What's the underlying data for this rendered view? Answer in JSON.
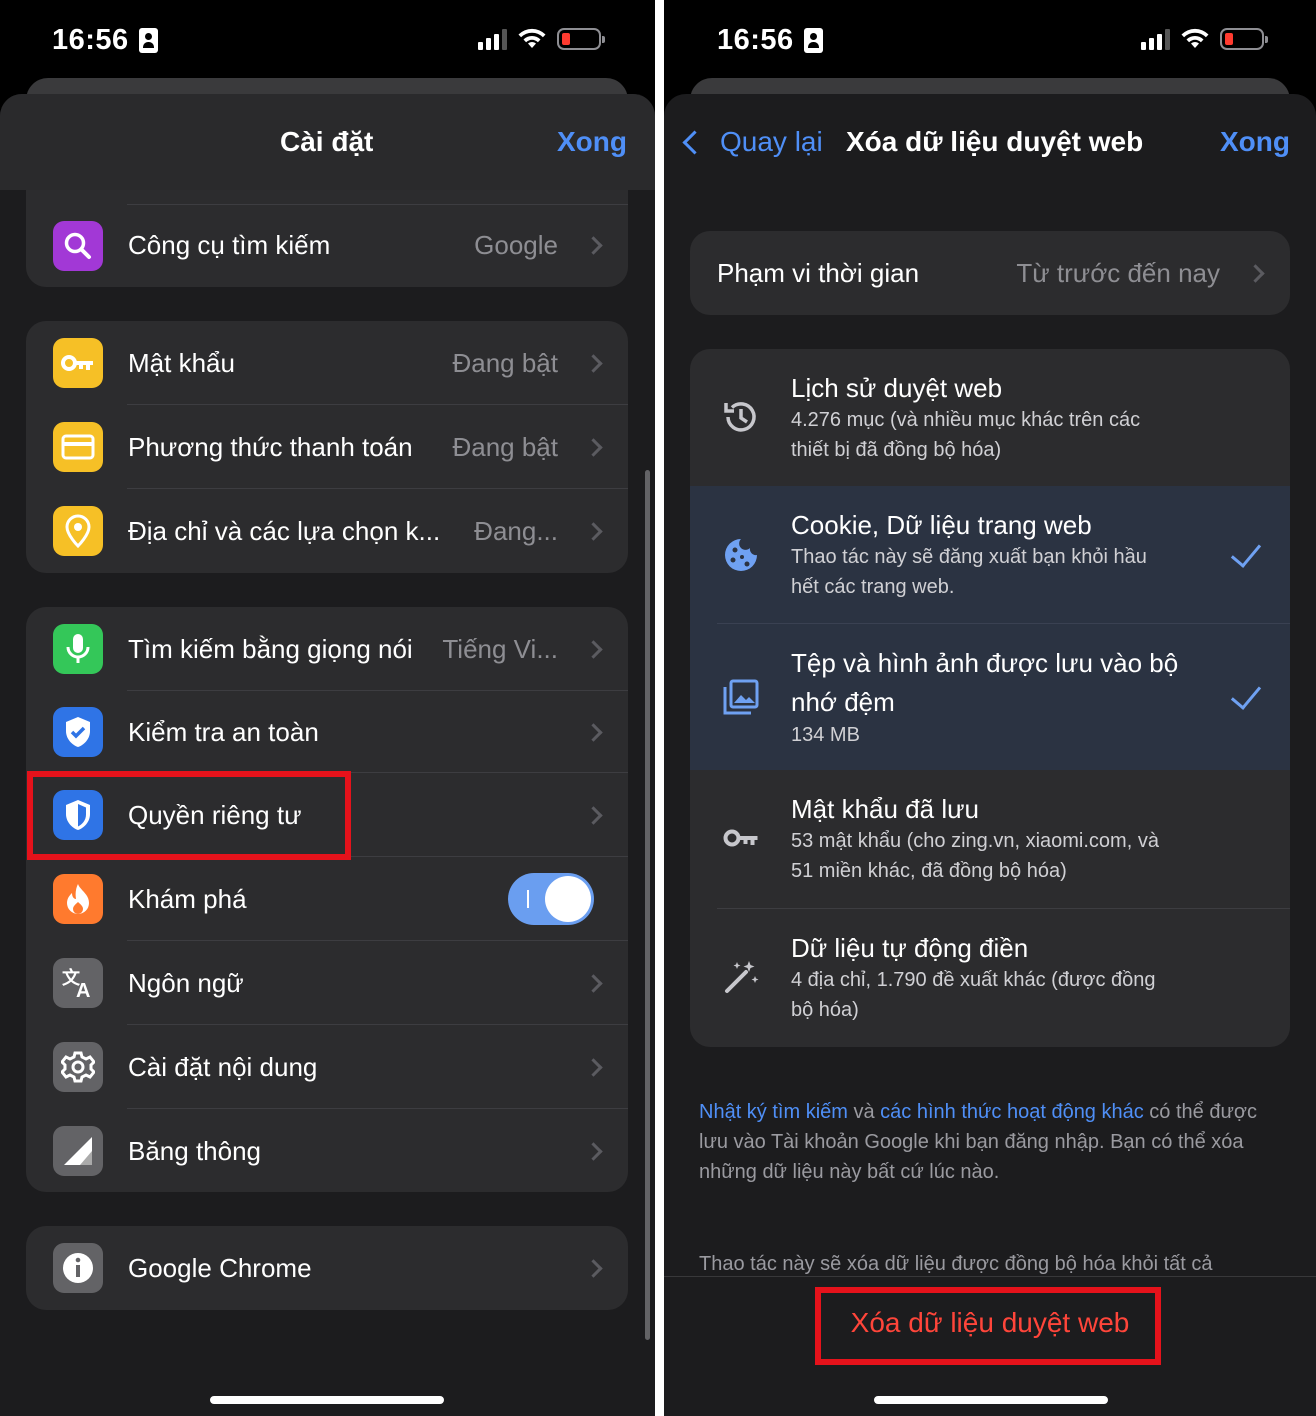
{
  "left": {
    "status": {
      "time": "16:56"
    },
    "nav": {
      "title": "Cài đặt",
      "done": "Xong"
    },
    "search_engine": {
      "label": "Công cụ tìm kiếm",
      "value": "Google"
    },
    "autofill": [
      {
        "label": "Mật khẩu",
        "value": "Đang bật",
        "icon": "key-icon"
      },
      {
        "label": "Phương thức thanh toán",
        "value": "Đang bật",
        "icon": "card-icon"
      },
      {
        "label": "Địa chỉ và các lựa chọn k...",
        "value": "Đang...",
        "icon": "location-pin-icon"
      }
    ],
    "advanced": [
      {
        "label": "Tìm kiếm bằng giọng nói",
        "value": "Tiếng Vi...",
        "icon": "microphone-icon"
      },
      {
        "label": "Kiểm tra an toàn",
        "value": "",
        "icon": "shield-check-icon"
      },
      {
        "label": "Quyền riêng tư",
        "value": "",
        "icon": "privacy-shield-icon"
      },
      {
        "label": "Khám phá",
        "value": "",
        "icon": "flame-icon",
        "toggle": true
      },
      {
        "label": "Ngôn ngữ",
        "value": "",
        "icon": "translate-icon"
      },
      {
        "label": "Cài đặt nội dung",
        "value": "",
        "icon": "gear-icon"
      },
      {
        "label": "Băng thông",
        "value": "",
        "icon": "bandwidth-icon"
      }
    ],
    "about": {
      "label": "Google Chrome",
      "icon": "info-icon"
    }
  },
  "right": {
    "status": {
      "time": "16:56"
    },
    "nav": {
      "back": "Quay lại",
      "title": "Xóa dữ liệu duyệt web",
      "done": "Xong"
    },
    "time_range": {
      "label": "Phạm vi thời gian",
      "value": "Từ trước đến nay"
    },
    "items": [
      {
        "title": "Lịch sử duyệt web",
        "sub1": "4.276 mục (và nhiều mục khác trên các",
        "sub2": "thiết bị đã đồng bộ hóa)",
        "selected": false,
        "icon": "history-icon"
      },
      {
        "title": "Cookie, Dữ liệu trang web",
        "sub1": "Thao tác này sẽ đăng xuất bạn khỏi hầu",
        "sub2": "hết các trang web.",
        "selected": true,
        "icon": "cookie-icon"
      },
      {
        "title1": "Tệp và hình ảnh được lưu vào bộ",
        "title2": "nhớ đệm",
        "sub1": "134 MB",
        "selected": true,
        "icon": "image-stack-icon"
      },
      {
        "title": "Mật khẩu đã lưu",
        "sub1": "53 mật khẩu (cho zing.vn, xiaomi.com, và",
        "sub2": "51 miền khác, đã đồng bộ hóa)",
        "selected": false,
        "icon": "key-icon"
      },
      {
        "title": "Dữ liệu tự động điền",
        "sub1": "4 địa chỉ, 1.790 đề xuất khác (được đồng",
        "sub2": "bộ hóa)",
        "selected": false,
        "icon": "magic-wand-icon"
      }
    ],
    "footnote": {
      "link1": "Nhật ký tìm kiếm",
      "and": " và ",
      "link2": "các hình thức hoạt động khác",
      "rest": " có thể được lưu vào Tài khoản Google khi bạn đăng nhập. Bạn có thể xóa những dữ liệu này bất cứ lúc nào."
    },
    "footnote2": "Thao tác này sẽ xóa dữ liệu được đồng bộ hóa khỏi tất cả",
    "clear_button": "Xóa dữ liệu duyệt web"
  },
  "colors": {
    "accent": "#4f8ff7",
    "destructive": "#ff453a",
    "highlight": "#e5121b"
  }
}
